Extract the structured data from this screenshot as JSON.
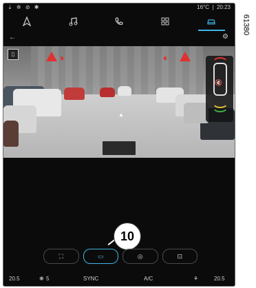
{
  "status_bar": {
    "left_icons": "⇣ ✲ ⊘ ✱",
    "temperature": "16°C",
    "time": "20:23"
  },
  "tabs": [
    {
      "icon": "navigation-icon",
      "active": false
    },
    {
      "icon": "music-icon",
      "active": false
    },
    {
      "icon": "phone-icon",
      "active": false
    },
    {
      "icon": "apps-icon",
      "active": false
    },
    {
      "icon": "car-icon",
      "active": true
    }
  ],
  "nav": {
    "back_label": "←",
    "settings_icon": "gear-icon"
  },
  "camera": {
    "battery": "▯",
    "crosshair": "▲",
    "mute": "🔇"
  },
  "modes": [
    {
      "icon": "rear-camera-mode-icon",
      "label": "⛶",
      "active": false
    },
    {
      "icon": "front-camera-icon",
      "label": "▭",
      "active": true
    },
    {
      "icon": "360-view-icon",
      "label": "◎",
      "active": false
    },
    {
      "icon": "top-view-icon",
      "label": "⊡",
      "active": false
    }
  ],
  "callout": "10",
  "climate": {
    "left_temp": "20.5",
    "fan_left": "5",
    "sync": "SYNC",
    "ac": "A/C",
    "right_temp": "20.5"
  },
  "side_code": "61380",
  "colors": {
    "accent": "#3fb6e6",
    "warning": "#e03030"
  }
}
